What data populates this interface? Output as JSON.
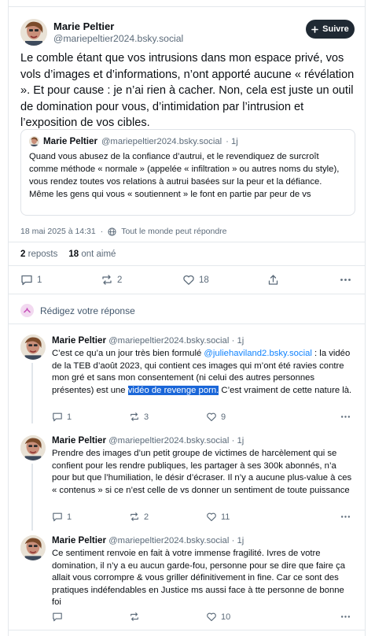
{
  "post": {
    "author_name": "Marie Peltier",
    "author_handle": "@mariepeltier2024.bsky.social",
    "follow_label": "Suivre",
    "text": "Le comble étant que vos intrusions dans mon espace privé, vos vols d’images et d’informations, n’ont apporté aucune « révélation ». Et pour cause : je n’ai rien à cacher. Non, cela est juste un outil de domination pour vous, d’intimidation par l’intrusion et l’exposition de vos cibles.",
    "quote": {
      "author_name": "Marie Peltier",
      "author_handle": "@mariepeltier2024.bsky.social",
      "time": "· 1j",
      "text": "Quand vous abusez de la confiance d’autrui, et le revendiquez de surcroît comme méthode « normale » (appelée « infiltration » ou autres noms du style), vous rendez toutes vos relations à autrui basées sur la peur et la défiance. Même les gens qui vous « soutiennent » le font en partie par peur de vs"
    },
    "date": "18 mai 2025 à 14:31",
    "separator": "·",
    "audience": "Tout le monde peut répondre",
    "reposts_count": "2",
    "reposts_label": "reposts",
    "likes_count": "18",
    "likes_label": "ont aimé",
    "actions": {
      "replies": "1",
      "reposts": "2",
      "likes": "18"
    }
  },
  "reply_prompt": "Rédigez votre réponse",
  "replies": [
    {
      "author_name": "Marie Peltier",
      "author_handle": "@mariepeltier2024.bsky.social",
      "time": "· 1j",
      "text_before": "C’est ce qu’a un jour très bien formulé ",
      "mention": "@juliehaviland2.bsky.social",
      "text_middle": " : la vidéo de la TEB d’août 2023, qui contient ces images qui m’ont été ravies contre mon gré et sans mon consentement (ni celui des autres personnes présentes) est une ",
      "highlight": "vidéo de revenge porn.",
      "text_after": " C’est vraiment de cette nature là.",
      "actions": {
        "replies": "1",
        "reposts": "3",
        "likes": "9"
      }
    },
    {
      "author_name": "Marie Peltier",
      "author_handle": "@mariepeltier2024.bsky.social",
      "time": "· 1j",
      "text": "Prendre des images d’un petit groupe de victimes de harcèlement qui se confient pour les rendre publiques, les partager à ses 300k abonnés, n’a pour but que l’humiliation, le désir d’écraser. Il n’y a aucune plus-value à ces « contenus » si ce n’est celle de vs donner un sentiment de toute puissance",
      "actions": {
        "replies": "1",
        "reposts": "2",
        "likes": "11"
      }
    },
    {
      "author_name": "Marie Peltier",
      "author_handle": "@mariepeltier2024.bsky.social",
      "time": "· 1j",
      "text": "Ce sentiment renvoie en fait à votre immense fragilité. Ivres de votre domination, il n’y a eu aucun garde-fou, personne pour se dire que faire ça allait vous corrompre & vous griller définitivement in fine. Car ce sont des pratiques indéfendables en Justice ms aussi face à tte personne de bonne foi",
      "actions": {
        "replies": "",
        "reposts": "",
        "likes": "10"
      }
    }
  ],
  "icons": [
    "avatar",
    "plus-icon",
    "globe-icon",
    "reply-icon",
    "repost-icon",
    "heart-icon",
    "share-icon",
    "more-icon",
    "compose-reply-icon"
  ],
  "colors": {
    "follow_bg": "#1f2933",
    "link": "#1083fe",
    "highlight": "#1a66d8",
    "muted": "#5c6b7a",
    "divider": "#e4e8ec"
  }
}
